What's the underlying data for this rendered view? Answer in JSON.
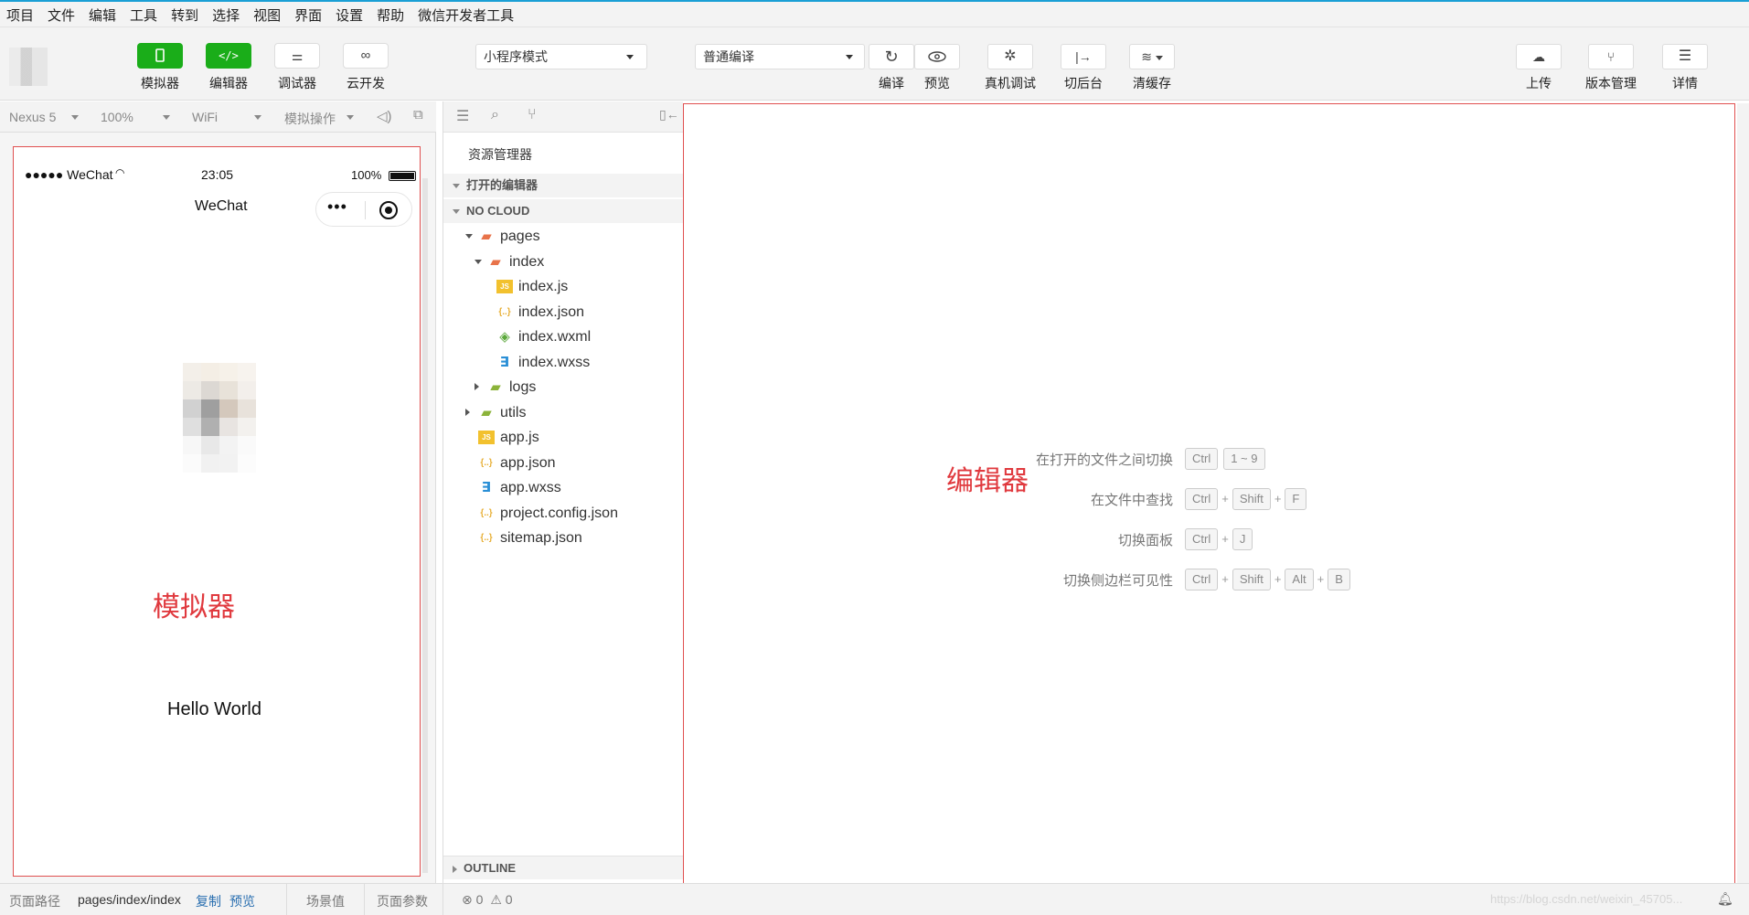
{
  "menubar": {
    "items": [
      "项目",
      "文件",
      "编辑",
      "工具",
      "转到",
      "选择",
      "视图",
      "界面",
      "设置",
      "帮助",
      "微信开发者工具"
    ]
  },
  "toolbar": {
    "left_buttons": [
      "模拟器",
      "编辑器",
      "调试器",
      "云开发"
    ],
    "mode_select": "小程序模式",
    "compile_select": "普通编译",
    "mid_buttons": [
      "编译",
      "预览",
      "真机调试",
      "切后台",
      "清缓存"
    ],
    "right_buttons": [
      "上传",
      "版本管理",
      "详情"
    ]
  },
  "simulator_bar": {
    "device": "Nexus 5",
    "zoom": "100%",
    "network": "WiFi",
    "ops": "模拟操作"
  },
  "phone": {
    "carrier": "●●●●● WeChat",
    "time": "23:05",
    "battery": "100%",
    "nav_title": "WeChat",
    "annotation": "模拟器",
    "hello": "Hello World"
  },
  "explorer": {
    "title": "资源管理器",
    "open_editors": "打开的编辑器",
    "project": "NO CLOUD",
    "outline": "OUTLINE",
    "tree": [
      {
        "name": "pages",
        "depth": 0,
        "kind": "folder-open",
        "arrow": "down"
      },
      {
        "name": "index",
        "depth": 1,
        "kind": "folder-open",
        "arrow": "down"
      },
      {
        "name": "index.js",
        "depth": 2,
        "kind": "js",
        "arrow": ""
      },
      {
        "name": "index.json",
        "depth": 2,
        "kind": "json",
        "arrow": ""
      },
      {
        "name": "index.wxml",
        "depth": 2,
        "kind": "wxml",
        "arrow": ""
      },
      {
        "name": "index.wxss",
        "depth": 2,
        "kind": "wxss",
        "arrow": ""
      },
      {
        "name": "logs",
        "depth": 1,
        "kind": "folder",
        "arrow": "right"
      },
      {
        "name": "utils",
        "depth": 0,
        "kind": "folder",
        "arrow": "right"
      },
      {
        "name": "app.js",
        "depth": 0,
        "kind": "js",
        "arrow": ""
      },
      {
        "name": "app.json",
        "depth": 0,
        "kind": "json",
        "arrow": ""
      },
      {
        "name": "app.wxss",
        "depth": 0,
        "kind": "wxss",
        "arrow": ""
      },
      {
        "name": "project.config.json",
        "depth": 0,
        "kind": "json",
        "arrow": ""
      },
      {
        "name": "sitemap.json",
        "depth": 0,
        "kind": "json",
        "arrow": ""
      }
    ]
  },
  "editor": {
    "annotation": "编辑器",
    "shortcuts": [
      {
        "label": "在打开的文件之间切换",
        "keys": [
          "Ctrl",
          "1 ~ 9"
        ],
        "joined": false
      },
      {
        "label": "在文件中查找",
        "keys": [
          "Ctrl",
          "Shift",
          "F"
        ],
        "joined": true
      },
      {
        "label": "切换面板",
        "keys": [
          "Ctrl",
          "J"
        ],
        "joined": true
      },
      {
        "label": "切换侧边栏可见性",
        "keys": [
          "Ctrl",
          "Shift",
          "Alt",
          "B"
        ],
        "joined": true
      }
    ]
  },
  "statusbar": {
    "path_label": "页面路径",
    "path": "pages/index/index",
    "copy": "复制",
    "preview": "预览",
    "scene": "场景值",
    "params": "页面参数",
    "errors": "0",
    "warnings": "0",
    "watermark": "https://blog.csdn.net/weixin_45705..."
  },
  "colors": {
    "accent": "#1aad19",
    "annotation": "#e0393e",
    "border_red": "#e05050"
  }
}
